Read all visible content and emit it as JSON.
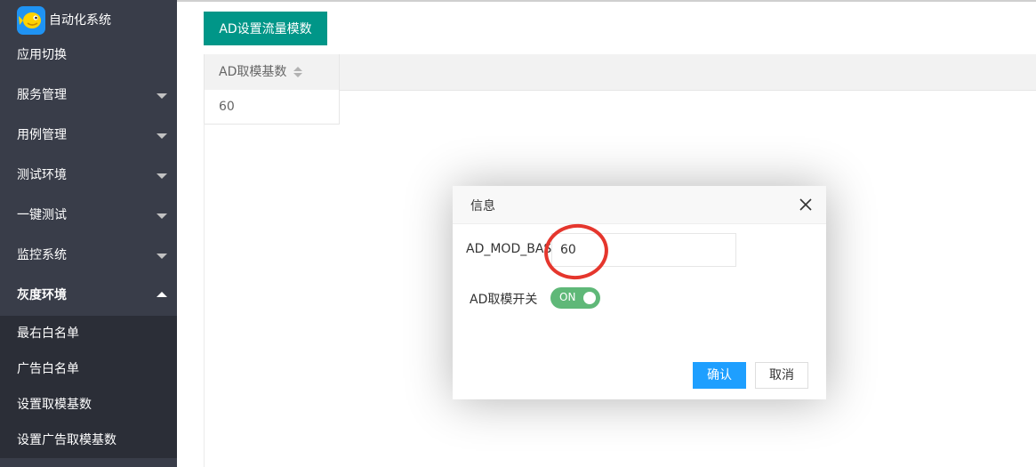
{
  "app": {
    "title": "自动化系统",
    "logo_icon": "fish-logo-icon",
    "accent": "#009688"
  },
  "sidebar": {
    "items": [
      {
        "label": "应用切换"
      },
      {
        "label": "服务管理"
      },
      {
        "label": "用例管理"
      },
      {
        "label": "测试环境"
      },
      {
        "label": "一键测试"
      },
      {
        "label": "监控系统"
      },
      {
        "label": "灰度环境"
      }
    ],
    "submenu": [
      {
        "label": "最右白名单"
      },
      {
        "label": "广告白名单"
      },
      {
        "label": "设置取模基数"
      },
      {
        "label": "设置广告取模基数"
      }
    ]
  },
  "toolbar": {
    "primary_button": "AD设置流量模数"
  },
  "table": {
    "columns": [
      {
        "label": "AD取模基数"
      }
    ],
    "rows": [
      [
        "60"
      ]
    ]
  },
  "dialog": {
    "title": "信息",
    "field1_label": "AD_MOD_BASE",
    "field1_value": "60",
    "field2_label": "AD取模开关",
    "switch_label": "ON",
    "switch_on": true,
    "confirm_label": "确认",
    "cancel_label": "取消",
    "confirm_color": "#1E9FFF",
    "switch_color": "#5FB878"
  }
}
